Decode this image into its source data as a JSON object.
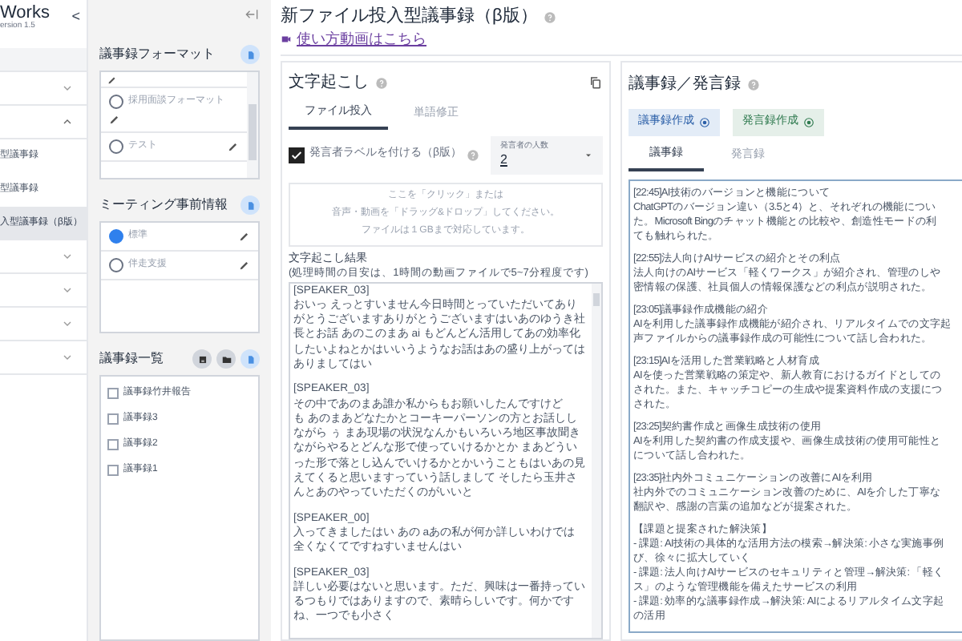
{
  "sidebar": {
    "brand": "Works",
    "version": "ersion 1.5",
    "collapse": "<",
    "menu": [
      {
        "expanded": false
      },
      {
        "expanded": true,
        "children": [
          {
            "label": "型議事録",
            "selected": false
          },
          {
            "label": "型議事録",
            "selected": false
          },
          {
            "label": "入型議事録（β版）",
            "selected": true
          }
        ]
      },
      {
        "expanded": false
      },
      {
        "expanded": false
      },
      {
        "expanded": false
      },
      {
        "expanded": false
      }
    ]
  },
  "formats": {
    "title": "議事録フォーマット",
    "items": [
      {
        "label": "採用面談フォーマット",
        "selected": false
      },
      {
        "label": "テスト",
        "selected": false
      }
    ]
  },
  "meeting_info": {
    "title": "ミーティング事前情報",
    "items": [
      {
        "label": "標準",
        "selected": true
      },
      {
        "label": "伴走支援",
        "selected": false
      }
    ]
  },
  "minutes_list": {
    "title": "議事録一覧",
    "items": [
      {
        "label": "議事録竹井報告",
        "checked": false
      },
      {
        "label": "議事録3",
        "checked": false
      },
      {
        "label": "議事録2",
        "checked": false
      },
      {
        "label": "議事録1",
        "checked": false
      }
    ]
  },
  "page": {
    "title": "新ファイル投入型議事録（β版）",
    "link": "使い方動画はこちら"
  },
  "transcription": {
    "title": "文字起こし",
    "tabs": [
      {
        "label": "ファイル投入",
        "selected": true
      },
      {
        "label": "単語修正",
        "selected": false
      }
    ],
    "speaker_label": {
      "label": "発言者ラベルを付ける（β版）",
      "checked": true
    },
    "speaker_count": {
      "label": "発言者の人数",
      "value": "2"
    },
    "dropzone": [
      "ここを「クリック」または",
      "音声・動画を「ドラッグ&ドロップ」してください。",
      "ファイルは１GBまで対応しています。"
    ],
    "result_label": "文字起こし結果",
    "result_note": "(処理時間の目安は、1時間の動画ファイルで5~7分程度です)",
    "segments": [
      {
        "speaker": "[SPEAKER_03]",
        "text": "おいっ えっとすいません今日時間とっていただいてありがとうございますありがとうございますはいあのゆうき社長とお話 あのこのまあ ai もどんどん活用してあの効率化したいよねとかはいいうようなお話はあの盛り上がってはありましてはい"
      },
      {
        "speaker": "[SPEAKER_03]",
        "text": "その中であのまあ誰か私からもお願いしたんですけども あのまあどなたかとコーキーパーソンの方とお話ししながら ぅ まあ現場の状況なんかもいろいろ地区事故聞きながらやるとどんな形で使っていけるかとか まあどういった形で落とし込んでいけるかとかいうこともはいあの見えてくると思いますっていう話しまして そしたら玉井さんとあのやっていただくのがいいと"
      },
      {
        "speaker": "[SPEAKER_00]",
        "text": "入ってきましたはい あの aあの私が何か詳しいわけでは全くなくてですねすいませんはい"
      },
      {
        "speaker": "[SPEAKER_03]",
        "text": "詳しい必要はないと思います。ただ、興味は一番持っているつもりではありますので、素晴らしいです。何かですね、一つでも小さく"
      }
    ]
  },
  "minutes": {
    "title": "議事録／発言録",
    "buttons": [
      {
        "label": "議事録作成",
        "kind": "minutes"
      },
      {
        "label": "発言録作成",
        "kind": "speech"
      }
    ],
    "tabs": [
      {
        "label": "議事録",
        "selected": true
      },
      {
        "label": "発言録",
        "selected": false
      }
    ],
    "paragraphs": [
      {
        "lines": [
          "[22:45]AI技術のバージョンと機能について",
          "ChatGPTのバージョン違い（3.5と4）と、それぞれの機能につい",
          "た。Microsoft Bingのチャット機能との比較や、創造性モードの利",
          "ても触れられた。"
        ]
      },
      {
        "lines": [
          "[22:55]法人向けAIサービスの紹介とその利点",
          "法人向けのAIサービス「軽くワークス」が紹介され、管理のしや",
          "密情報の保護、社員個人の情報保護などの利点が説明された。"
        ]
      },
      {
        "lines": [
          "[23:05]議事録作成機能の紹介",
          "AIを利用した議事録作成機能が紹介され、リアルタイムでの文字起",
          "声ファイルからの議事録作成の可能性について話し合われた。"
        ]
      },
      {
        "lines": [
          "[23:15]AIを活用した営業戦略と人材育成",
          "AIを使った営業戦略の策定や、新人教育におけるガイドとしての",
          "された。また、キャッチコピーの生成や提案資料作成の支援につ",
          "された。"
        ]
      },
      {
        "lines": [
          "[23:25]契約書作成と画像生成技術の使用",
          "AIを利用した契約書の作成支援や、画像生成技術の使用可能性と",
          "について話し合われた。"
        ]
      },
      {
        "lines": [
          "[23:35]社内外コミュニケーションの改善にAIを利用",
          "社内外でのコミュニケーション改善のために、AIを介した丁寧な",
          "翻訳や、感謝の言葉の追加などが提案された。"
        ]
      },
      {
        "lines": [
          "【課題と提案された解決策】",
          "- 課題: AI技術の具体的な活用方法の模索→解決策: 小さな実施事例",
          "び、徐々に拡大していく",
          "- 課題: 法人向けAIサービスのセキュリティと管理→解決策: 「軽く",
          "ス」のような管理機能を備えたサービスの利用",
          "- 課題: 効率的な議事録作成→解決策: AIによるリアルタイム文字起",
          "の活用"
        ]
      }
    ]
  }
}
